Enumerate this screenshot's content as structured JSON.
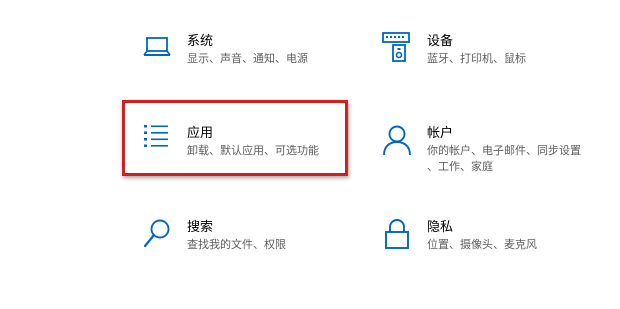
{
  "accent_color": "#0067c0",
  "highlight_color": "#d41f1f",
  "tiles": {
    "system": {
      "title": "系统",
      "desc": "显示、声音、通知、电源",
      "icon": "laptop-icon"
    },
    "devices": {
      "title": "设备",
      "desc": "蓝牙、打印机、鼠标",
      "icon": "keyboard-icon"
    },
    "apps": {
      "title": "应用",
      "desc": "卸载、默认应用、可选功能",
      "icon": "apps-list-icon",
      "highlighted": true
    },
    "accounts": {
      "title": "帐户",
      "desc_line1": "你的帐户、电子邮件、同步设置",
      "desc_line2": "、工作、家庭",
      "icon": "person-icon"
    },
    "search": {
      "title": "搜索",
      "desc": "查找我的文件、权限",
      "icon": "search-icon"
    },
    "privacy": {
      "title": "隐私",
      "desc": "位置、摄像头、麦克风",
      "icon": "lock-icon"
    }
  }
}
